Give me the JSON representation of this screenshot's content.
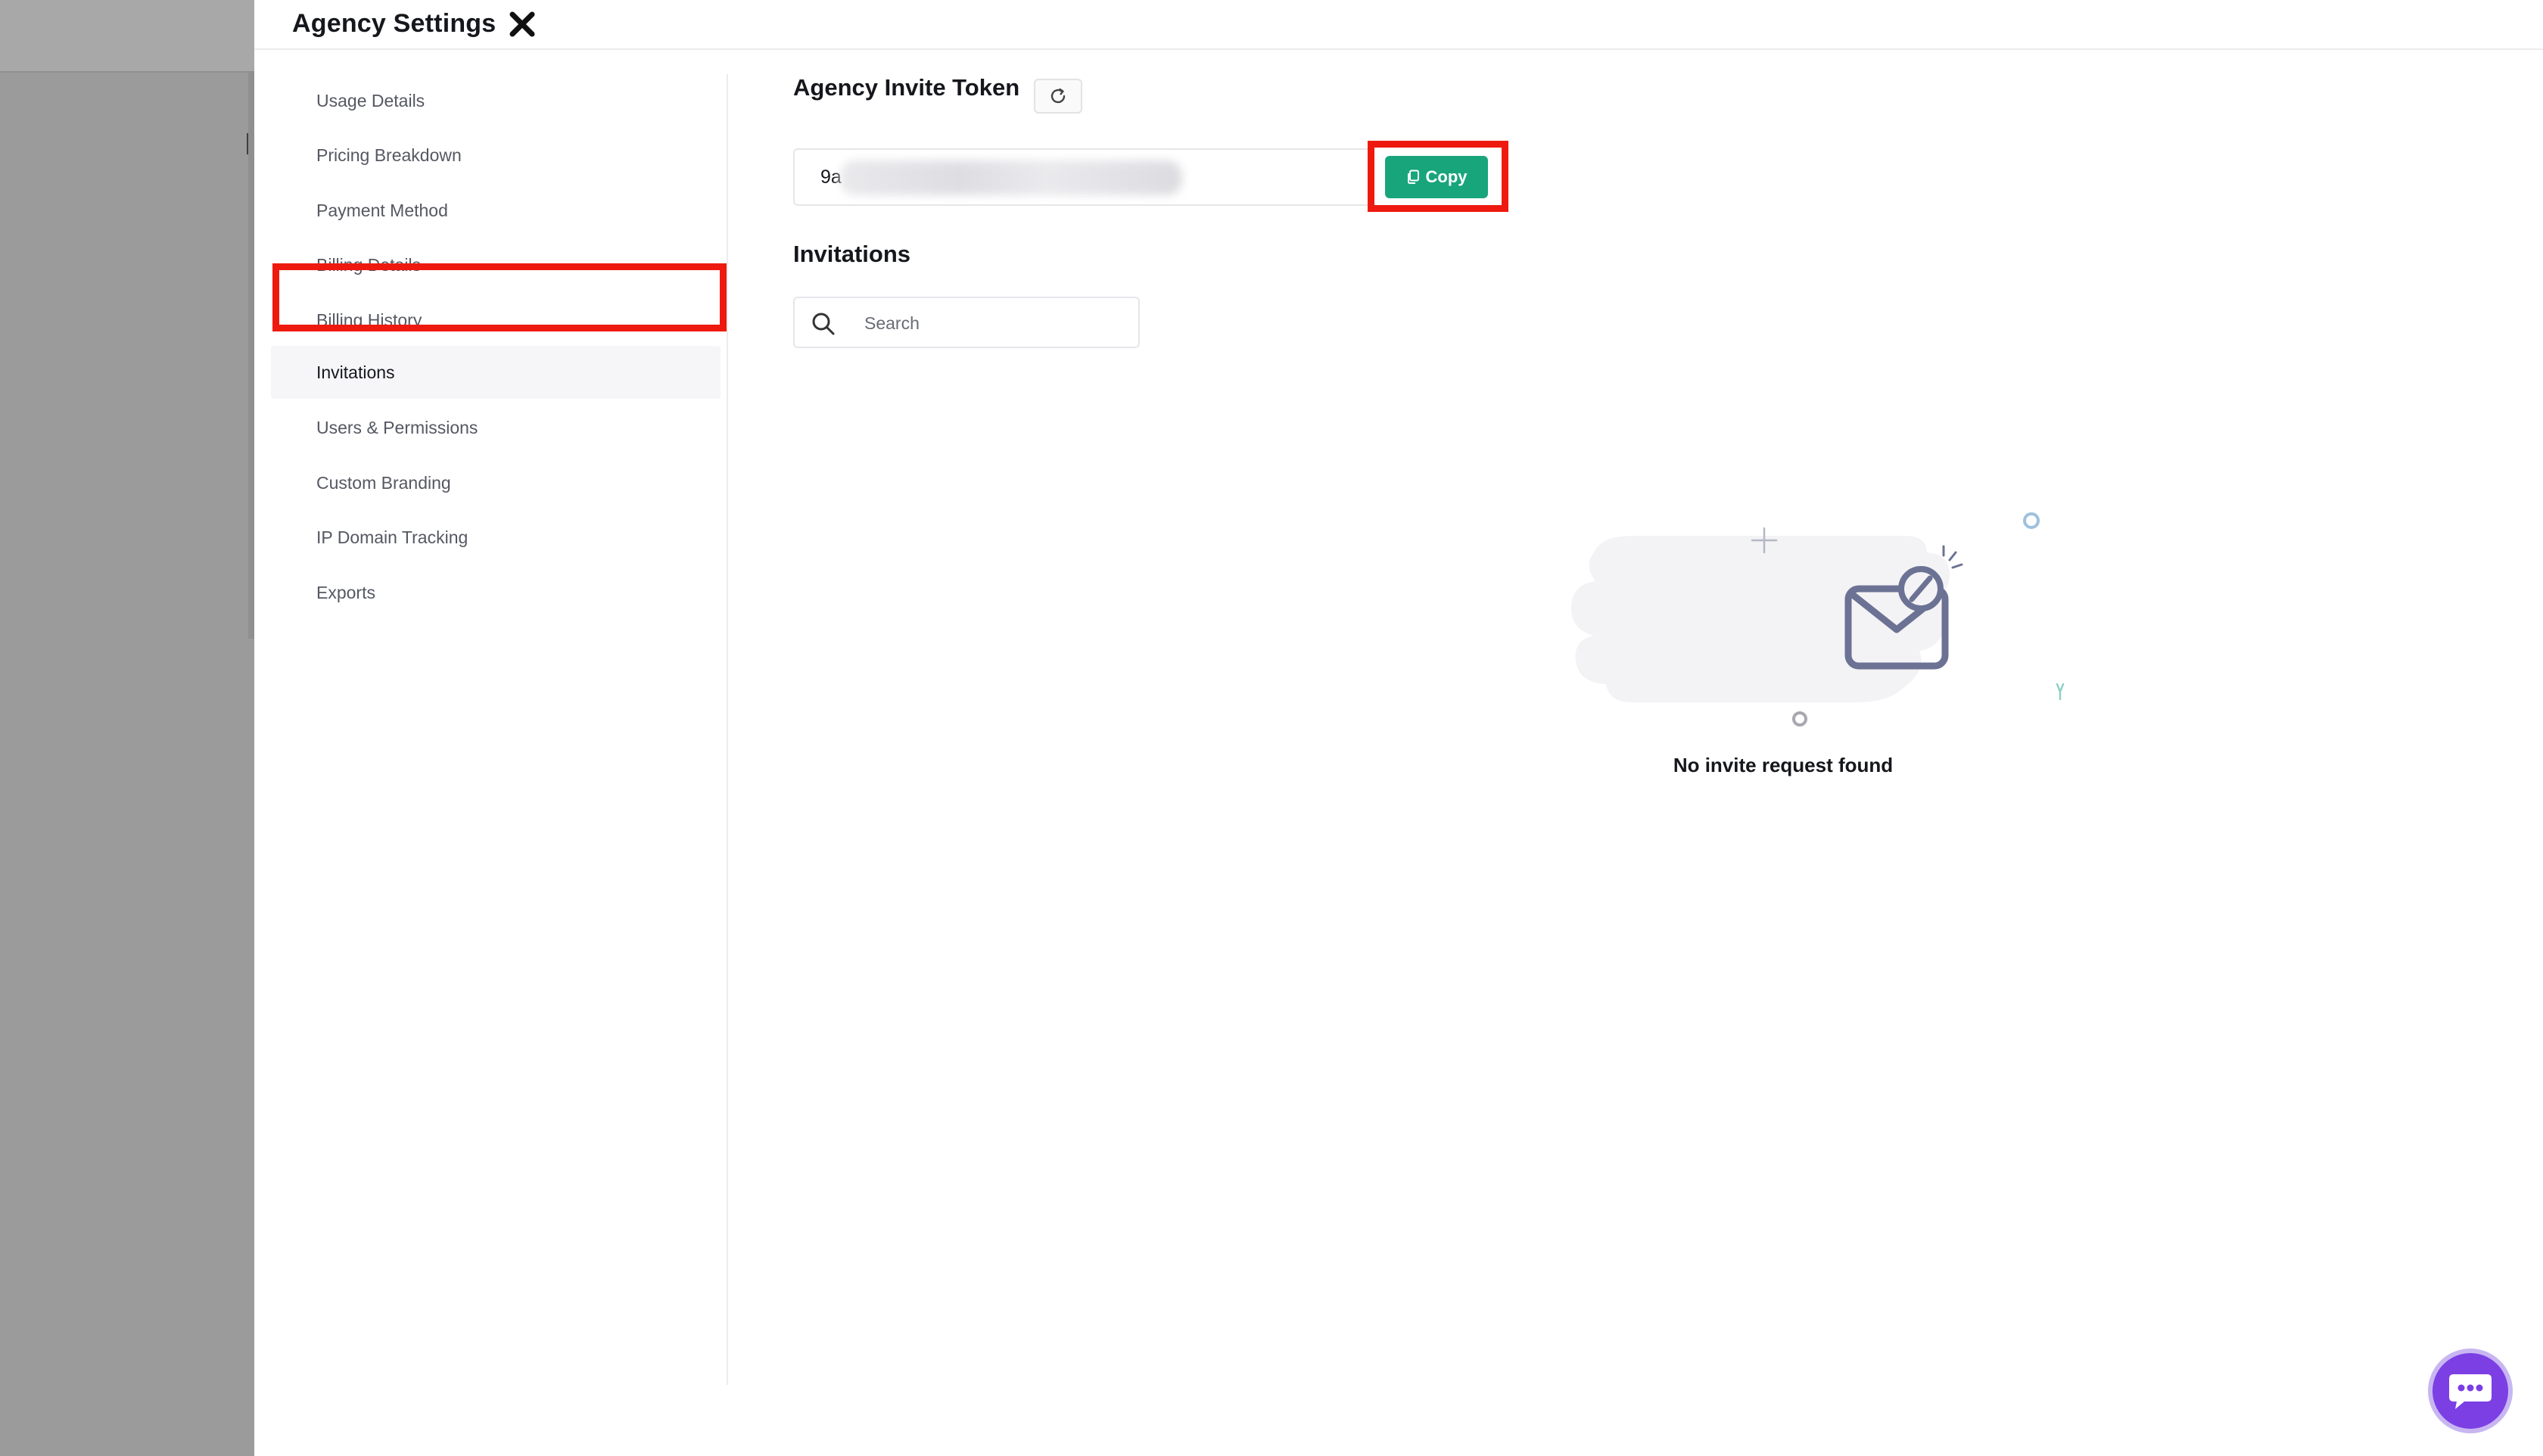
{
  "drawer": {
    "title": "Agency Settings"
  },
  "sidebar": {
    "items": [
      {
        "label": "Usage Details"
      },
      {
        "label": "Pricing Breakdown"
      },
      {
        "label": "Payment Method"
      },
      {
        "label": "Billing Details"
      },
      {
        "label": "Billing History"
      },
      {
        "label": "Invitations",
        "active": true
      },
      {
        "label": "Users & Permissions"
      },
      {
        "label": "Custom Branding"
      },
      {
        "label": "IP Domain Tracking"
      },
      {
        "label": "Exports"
      }
    ]
  },
  "token": {
    "title": "Agency Invite Token",
    "value_visible": "9a",
    "copy_label": "Copy"
  },
  "invitations": {
    "title": "Invitations",
    "search_placeholder": "Search",
    "empty_message": "No invite request found"
  },
  "colors": {
    "accent_green": "#19a57c",
    "highlight_red": "#ee1a0f",
    "chat_purple": "#7b3fe4"
  }
}
